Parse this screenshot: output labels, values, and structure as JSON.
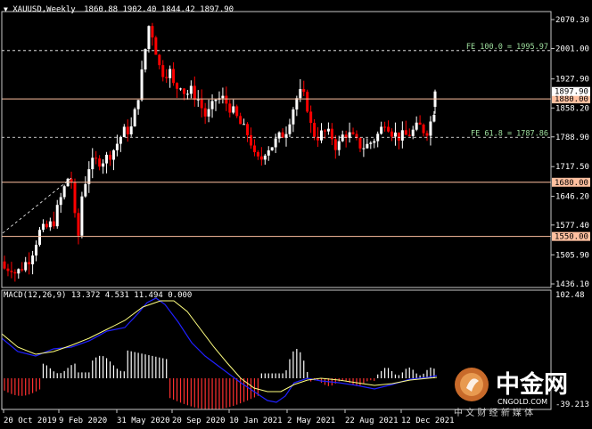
{
  "header": {
    "symbol": "XAUUSD,Weekly",
    "ohlc": "1860.88 1902.40 1844.42 1897.90",
    "menu_icon": "triangle-down-icon"
  },
  "macd": {
    "label": "MACD(12,26,9) 13.372 4.531 11.494 0.000",
    "top_value": "102.48",
    "bottom_value": "-39.213"
  },
  "colors": {
    "background": "#000000",
    "frame": "#c8c8c8",
    "bull": "#ffffff",
    "bear": "#ff0000",
    "hline": "#ffc0a0",
    "fibo": "#ffffff",
    "macd_hist_pos": "#ffffff",
    "macd_hist_neg": "#ff3030",
    "macd_line": "#2020ff",
    "signal_line": "#ffff80"
  },
  "price_axis": {
    "labels": [
      "2070.30",
      "2001.00",
      "1927.90",
      "1858.20",
      "1788.90",
      "1717.50",
      "1646.20",
      "1577.40",
      "1505.90",
      "1436.10"
    ]
  },
  "level_tags": [
    {
      "text": "1880.00",
      "price": 1880
    },
    {
      "text": "1680.00",
      "price": 1680
    },
    {
      "text": "1550.00",
      "price": 1550
    }
  ],
  "current_price_tag": {
    "text": "1897.90",
    "price": 1897.9
  },
  "fibo": [
    {
      "text": "FE 100.0 = 1995.97",
      "price": 1995.97
    },
    {
      "text": "FE 61.8 = 1787.86",
      "price": 1787.86
    }
  ],
  "time_axis": {
    "labels": [
      "20 Oct 2019",
      "9 Feb 2020",
      "31 May 2020",
      "20 Sep 2020",
      "10 Jan 2021",
      "2 May 2021",
      "22 Aug 2021",
      "12 Dec 2021"
    ]
  },
  "logo": {
    "brand": "中金网",
    "domain": "CNGOLD.COM",
    "tagline": "中 文 财 经 新 媒 体"
  }
}
